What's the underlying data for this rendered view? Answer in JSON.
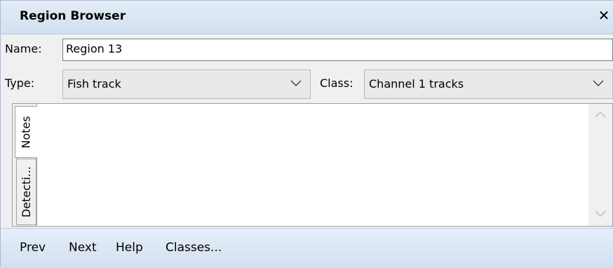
{
  "window": {
    "title": "Region Browser",
    "close_label": "✕"
  },
  "name_row": {
    "label": "Name:",
    "value": "Region 13"
  },
  "type_row": {
    "type_label": "Type:",
    "type_value": "Fish track",
    "class_label": "Class:",
    "class_value": "Channel 1 tracks"
  },
  "tabs": [
    {
      "label": "Notes",
      "selected": true
    },
    {
      "label": "Detecti...",
      "selected": false
    }
  ],
  "notes_text": "",
  "footer": {
    "prev": "Prev",
    "next": "Next",
    "help": "Help",
    "classes": "Classes..."
  },
  "colors": {
    "titlebar": "#d3e0f0",
    "border": "#a9b8cc"
  }
}
